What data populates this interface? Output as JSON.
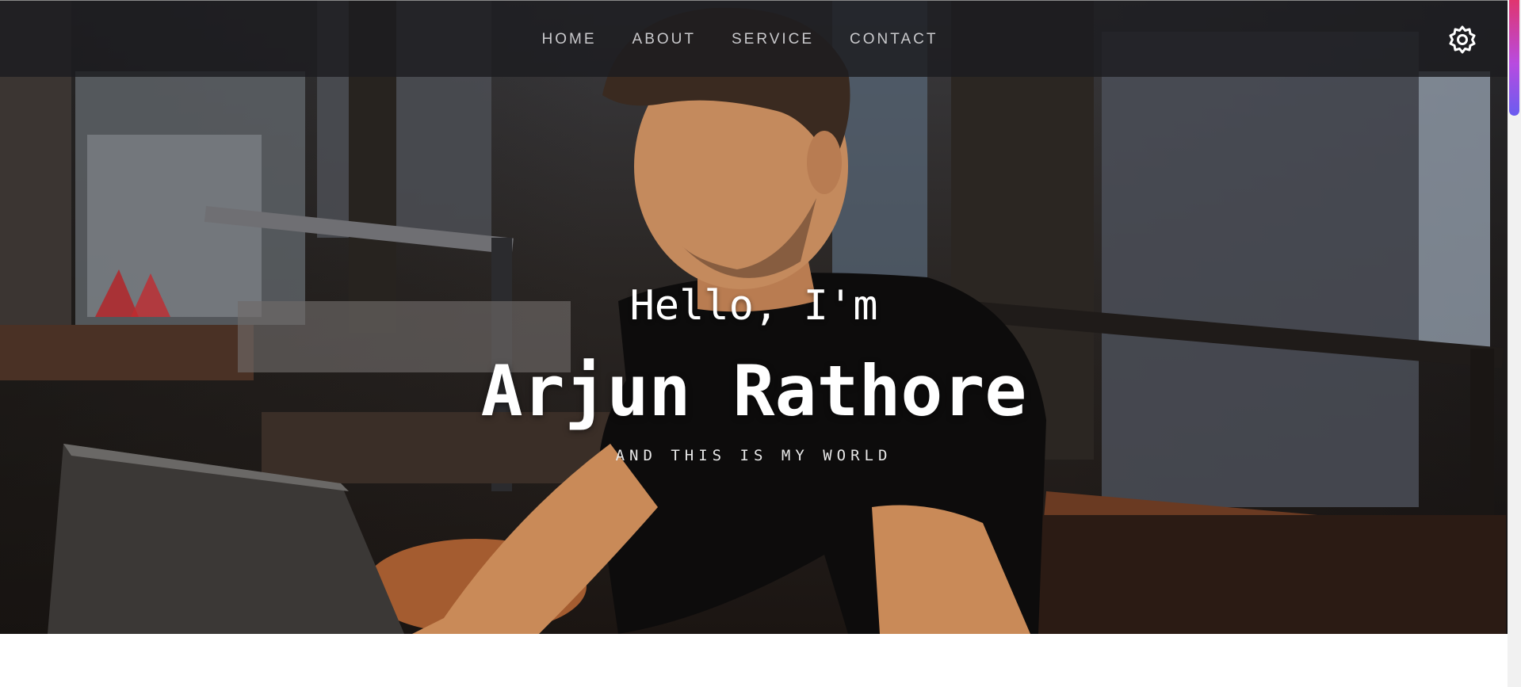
{
  "nav": {
    "items": [
      {
        "label": "HOME"
      },
      {
        "label": "ABOUT"
      },
      {
        "label": "SERVICE"
      },
      {
        "label": "CONTACT"
      }
    ],
    "settings_icon": "gear-icon"
  },
  "hero": {
    "greeting": "Hello, I'm",
    "name": "Arjun Rathore",
    "tagline": "AND THIS IS MY WORLD"
  },
  "colors": {
    "navbar_bg": "#1c1c20",
    "nav_text": "#c9c9cc",
    "hero_text": "#ffffff",
    "scroll_thumb_top": "#e0356f",
    "scroll_thumb_bottom": "#6a5cf0"
  }
}
